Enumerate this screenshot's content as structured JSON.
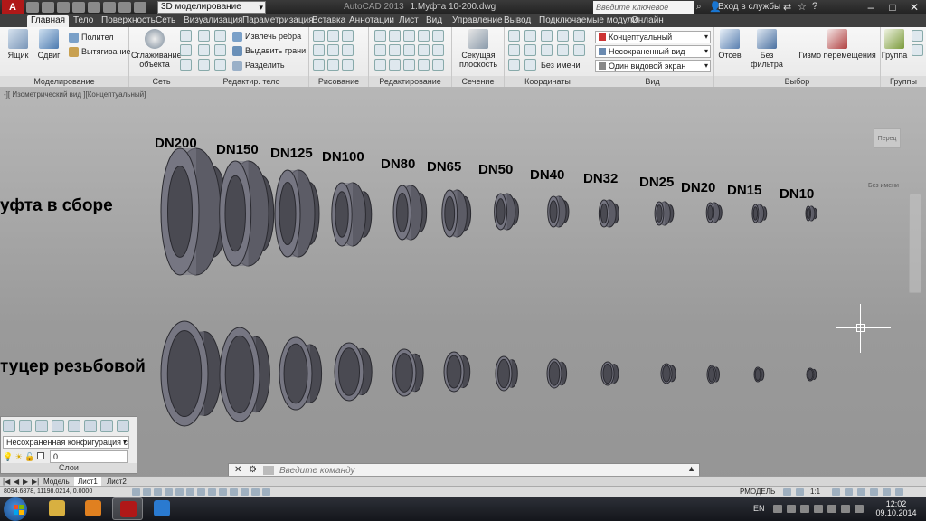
{
  "titlebar": {
    "app_logo": "A",
    "workspace": "3D моделирование",
    "app_title": "AutoCAD 2013",
    "document": "1.Муфта 10-200.dwg",
    "search_placeholder": "Введите ключевое слово/фразу",
    "login": "Вход в службы",
    "buttons": {
      "minimize": "–",
      "maximize": "□",
      "close": "✕"
    }
  },
  "tabs": [
    "Главная",
    "Тело",
    "Поверхность",
    "Сеть",
    "Визуализация",
    "Параметризация",
    "Вставка",
    "Аннотации",
    "Лист",
    "Вид",
    "Управление",
    "Вывод",
    "Подключаемые модули",
    "Онлайн"
  ],
  "ribbon": {
    "modeling": {
      "title": "Моделирование",
      "box": "Ящик",
      "extrude": "Сдвиг",
      "polysolid": "Полител",
      "presspull": "Вытягивание"
    },
    "mesh": {
      "title": "Сеть",
      "smooth": "Сглаживание объекта"
    },
    "solid_edit": {
      "title": "Редактир. тело",
      "extract_edges": "Извлечь ребра",
      "extrude_faces": "Выдавить грани",
      "separate": "Разделить"
    },
    "draw": {
      "title": "Рисование"
    },
    "modify": {
      "title": "Редактирование"
    },
    "section": {
      "title": "Сечение",
      "plane": "Секущая плоскость"
    },
    "coordinates": {
      "title": "Координаты",
      "unnamed": "Без имени"
    },
    "view": {
      "title": "Вид",
      "visual_style": "Концептуальный",
      "saved_view": "Несохраненный вид",
      "viewport_config": "Один видовой экран"
    },
    "selection": {
      "title": "Выбор",
      "culling": "Отсев",
      "no_filter": "Без фильтра",
      "gizmo": "Гизмо перемещения"
    },
    "groups": {
      "title": "Группы",
      "group": "Группа"
    }
  },
  "viewport": {
    "label": "-][ Изометрический вид ][Концептуальный]",
    "row1_label": "уфта в сборе",
    "row2_label": "туцер резьбовой",
    "dn_labels": [
      "DN200",
      "DN150",
      "DN125",
      "DN100",
      "DN80",
      "DN65",
      "DN50",
      "DN40",
      "DN32",
      "DN25",
      "DN20",
      "DN15",
      "DN10"
    ],
    "viewcube_face": "Перед",
    "wcs": "Без имени"
  },
  "layers": {
    "config": "Несохраненная конфигурация слс",
    "current": "0",
    "title": "Слои"
  },
  "cmdline": {
    "placeholder": "Введите команду"
  },
  "layout_tabs": [
    "Модель",
    "Лист1",
    "Лист2"
  ],
  "statusbar": {
    "coords": "8094.6878, 11198.0214, 0.0000",
    "space": "РМОДЕЛЬ",
    "scale": "1:1"
  },
  "taskbar": {
    "lang": "EN",
    "time": "12:02",
    "date": "09.10.2014"
  }
}
